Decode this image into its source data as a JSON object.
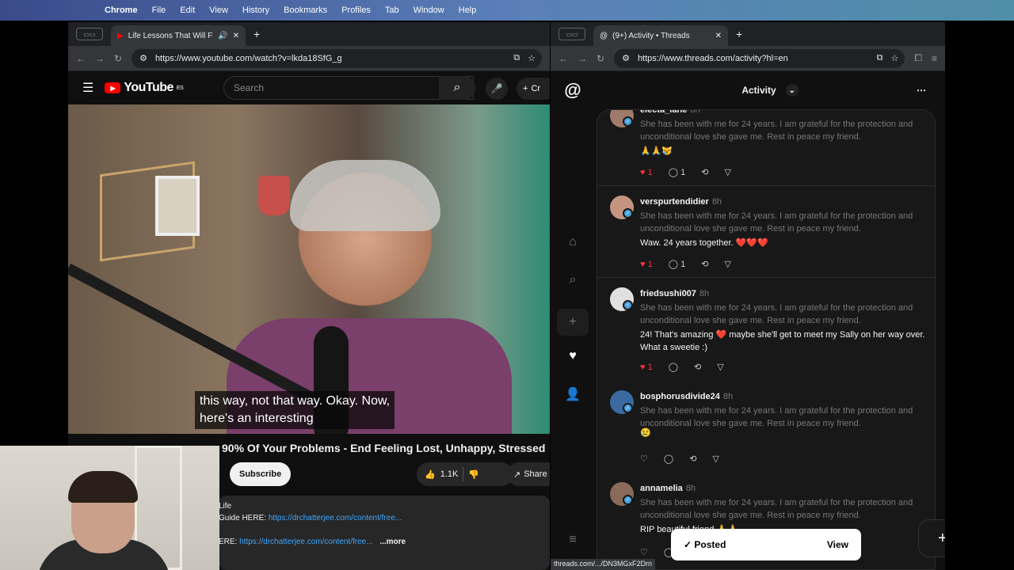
{
  "menubar": {
    "app": "Chrome",
    "items": [
      "File",
      "Edit",
      "View",
      "History",
      "Bookmarks",
      "Profiles",
      "Tab",
      "Window",
      "Help"
    ]
  },
  "youtube_window": {
    "tab_title": "Life Lessons That Will Fix",
    "url": "https://www.youtube.com/watch?v=lkda18SfG_g",
    "logo": "YouTube",
    "logo_region": "ES",
    "search_placeholder": "Search",
    "create_label": "Cr",
    "caption_line1": "this way, not that way. Okay. Now,",
    "caption_line2": "here's an interesting",
    "video_title": "90% Of Your Problems - End Feeling Lost, Unhappy, Stressed",
    "subscribe": "Subscribe",
    "likes": "1.1K",
    "share": "Share",
    "desc_line1": "Life",
    "desc_line2_prefix": "Guide HERE: ",
    "desc_line2_link": "https://drchatterjee.com/content/free...",
    "desc_line3_prefix": "ERE: ",
    "desc_line3_link": "https://drchatterjee.com/content/free...",
    "more": "...more"
  },
  "threads_window": {
    "tab_title": "(9+) Activity • Threads",
    "url": "https://www.threads.com/activity?hl=en",
    "header": "Activity",
    "quoted_text": "She has been with me for 24 years. I am grateful for the protection and unconditional love she gave me. Rest in peace my friend.",
    "posts": [
      {
        "user": "electa_lane",
        "time": "8h",
        "reply": "🙏🙏😿",
        "likes": "1",
        "replies": "1"
      },
      {
        "user": "verspurtendidier",
        "time": "8h",
        "reply": "Waw. 24 years together. ❤️❤️❤️",
        "likes": "1",
        "replies": "1"
      },
      {
        "user": "friedsushi007",
        "time": "8h",
        "reply": "24! That's amazing ❤️ maybe she'll get to meet my Sally on her way over. What a sweetie :)",
        "likes": "1",
        "replies": ""
      },
      {
        "user": "bosphorusdivide24",
        "time": "8h",
        "reply": "😢",
        "likes": "",
        "replies": ""
      },
      {
        "user": "annamelia",
        "time": "8h",
        "reply": "RIP beautiful friend 🙏🙏",
        "likes": "",
        "replies": ""
      }
    ],
    "toast_text": "Posted",
    "toast_action": "View",
    "status_url": "threads.com/.../DN3MGxF2Drn"
  },
  "icons": {
    "apple": "apple-icon",
    "back": "back-arrow-icon",
    "forward": "forward-arrow-icon",
    "reload": "reload-icon",
    "heart": "heart-icon",
    "comment": "comment-icon",
    "repost": "repost-icon",
    "send": "send-icon"
  },
  "colors": {
    "youtube_red": "#ff0000",
    "threads_like": "#ff3040",
    "verified_badge": "#4aa3df"
  }
}
